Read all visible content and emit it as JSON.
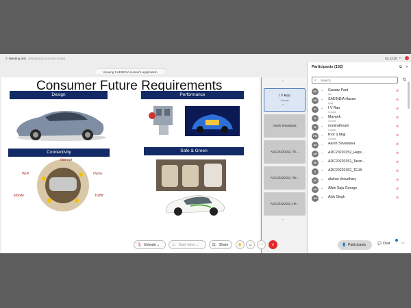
{
  "titlebar": {
    "meeting_info": "Meeting Info",
    "mode": "[Moderated unmute mode]",
    "time": "01:43:20"
  },
  "viewing": "Viewing SAEINDIA Hasan's application",
  "slide": {
    "title": "Consumer Future Requirements",
    "design": "Design",
    "performance": "Performance",
    "connectivity": "Connectivity",
    "safe_green": "Safe & Green",
    "conn_labels": [
      "Internet",
      "Wi-fi",
      "Home",
      "Mobile",
      "Traffic"
    ]
  },
  "thumbs": [
    {
      "name": "I V Rao",
      "role": "Cohost"
    },
    {
      "name": "Aarsh Srivastava"
    },
    {
      "name": "ADC20220152_TE..."
    },
    {
      "name": "ADC20220152_Tar..."
    },
    {
      "name": "ADC20220152_He..."
    }
  ],
  "participants": {
    "title": "Participants (152)",
    "search_placeholder": "Search",
    "list": [
      {
        "initials": "GP",
        "name": "Gaurav Pant",
        "role": "Me"
      },
      {
        "initials": "SH",
        "name": "SAEINDIA Hasan",
        "role": "Host"
      },
      {
        "initials": "IR",
        "name": "I V Rao",
        "role": "Cohost"
      },
      {
        "initials": "M",
        "name": "Mayank",
        "role": "Cohost"
      },
      {
        "initials": "M",
        "name": "munirathnam",
        "role": "Cohost"
      },
      {
        "initials": "PM",
        "name": "Prof S Maji",
        "role": "Cohost"
      },
      {
        "initials": "AS",
        "name": "Aarsh Srivastava",
        "role": ""
      },
      {
        "initials": "AH",
        "name": "ADC20220152_Heps...",
        "role": ""
      },
      {
        "initials": "AK",
        "name": "ADC20220152_Taran...",
        "role": ""
      },
      {
        "initials": "A",
        "name": "ADC20220152_TEJA",
        "role": ""
      },
      {
        "initials": "AC",
        "name": "akshat choudhary",
        "role": ""
      },
      {
        "initials": "AG",
        "name": "Albin Saju George",
        "role": ""
      },
      {
        "initials": "AS",
        "name": "Alok Singh",
        "role": ""
      }
    ]
  },
  "controls": {
    "unmute": "Unmute",
    "start_video": "Start video",
    "share": "Share",
    "participants": "Participants",
    "chat": "Chat"
  }
}
